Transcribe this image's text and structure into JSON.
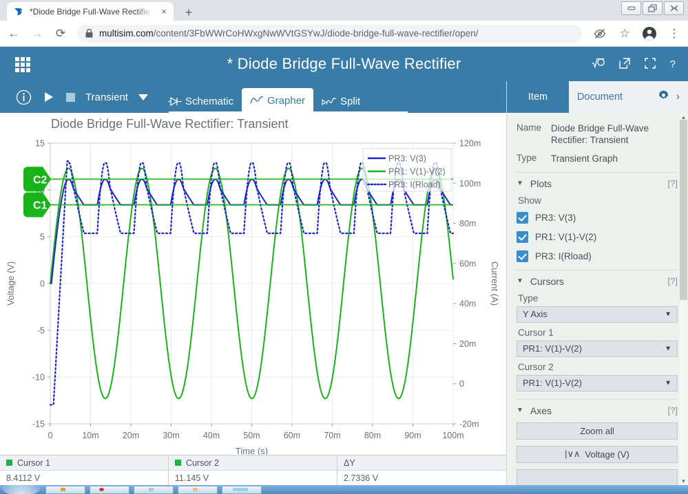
{
  "browser": {
    "tab": {
      "title": "*Diode Bridge Full-Wave Rectifie",
      "favicon": "multisim-bird-icon",
      "close": "×"
    },
    "newtab_label": "+",
    "window_controls": {
      "minimize": "–",
      "restore": "❐",
      "close": "✕"
    },
    "nav": {
      "back": "←",
      "forward": "→",
      "reload": "⟳"
    },
    "omnibox": {
      "lock": "lock-icon",
      "url_domain": "multisim.com",
      "url_path": "/content/3FbWWrCoHWxgNwWVtGSYwJ/diode-bridge-full-wave-rectifier/open/"
    },
    "right_icons": {
      "hidden": "eye-slash-icon",
      "bookmark": "☆",
      "profile": "profile-avatar-icon",
      "menu": "⋮"
    }
  },
  "app": {
    "grid_icon": "app-grid-icon",
    "title": "* Diode Bridge Full-Wave Rectifier",
    "header_icons": {
      "simulate": "√Ⓢ",
      "share": "↗",
      "fullscreen": "⛶",
      "help": "?"
    }
  },
  "toolbar": {
    "info": "ⓘ",
    "run": "▶",
    "stop": "■",
    "analysis": "Transient",
    "dropdown": "▼",
    "tabs": [
      {
        "label": "Schematic",
        "icon": "diode-icon",
        "active": false
      },
      {
        "label": "Grapher",
        "icon": "waveform-icon",
        "active": true
      },
      {
        "label": "Split",
        "icon": "split-view-icon",
        "active": false
      }
    ]
  },
  "chart_data": {
    "type": "line",
    "title": "Diode Bridge Full-Wave Rectifier: Transient",
    "xlabel": "Time (s)",
    "ylabel": "Voltage (V)",
    "y2label": "Current (A)",
    "xlim": [
      0,
      0.1
    ],
    "ylim": [
      -15,
      15
    ],
    "y2lim": [
      -0.02,
      0.12
    ],
    "xticks": [
      "0",
      "10m",
      "20m",
      "30m",
      "40m",
      "50m",
      "60m",
      "70m",
      "80m",
      "90m",
      "100m"
    ],
    "xtick_values": [
      0,
      0.01,
      0.02,
      0.03,
      0.04,
      0.05,
      0.06,
      0.07,
      0.08,
      0.09,
      0.1
    ],
    "yticks": [
      "15",
      "10",
      "5",
      "0",
      "-5",
      "-10",
      "-15"
    ],
    "ytick_values": [
      15,
      10,
      5,
      0,
      -5,
      -10,
      -15
    ],
    "y2ticks": [
      "120m",
      "100m",
      "80m",
      "60m",
      "40m",
      "20m",
      "0",
      "-20m"
    ],
    "y2tick_values": [
      0.12,
      0.1,
      0.08,
      0.06,
      0.04,
      0.02,
      0,
      -0.02
    ],
    "grid": true,
    "legend_position": "top-right",
    "series": [
      {
        "name": "PR3: V(3)",
        "color": "#1d25d0",
        "style": "solid",
        "axis": "left",
        "description": "Rectified DC output with ripple, peaks ~11.1 V, troughs ~8.4 V, ripple period ~9.1 ms",
        "peak": 11.1,
        "trough": 8.4,
        "ripple_period_s": 0.0091
      },
      {
        "name": "PR1: V(1)-V(2)",
        "color": "#18b318",
        "style": "solid",
        "axis": "left",
        "description": "AC input sine wave, amplitude 12.3 V, period ~18.2 ms (55 Hz)",
        "amplitude": 12.3,
        "period_s": 0.0182
      },
      {
        "name": "PR3: I(Rload)",
        "color": "#1d25d0",
        "style": "dotted",
        "axis": "right",
        "description": "Load current ripple, peaks ~111 mA, troughs ~84 mA",
        "peak": 0.111,
        "trough": 0.084
      }
    ],
    "cursors": [
      {
        "label": "C2",
        "axis": "left",
        "value": 11.145,
        "color": "#18b318"
      },
      {
        "label": "C1",
        "axis": "left",
        "value": 8.4112,
        "color": "#18b318"
      }
    ]
  },
  "status": {
    "columns": [
      {
        "marker": true,
        "header": "Cursor 1",
        "value": "8.4112 V"
      },
      {
        "marker": true,
        "header": "Cursor 2",
        "value": "11.145 V"
      },
      {
        "marker": false,
        "header": "ΔY",
        "value": "2.7336 V"
      }
    ]
  },
  "panel": {
    "tabs": [
      {
        "label": "Item",
        "active": true
      },
      {
        "label": "Document",
        "active": false
      }
    ],
    "gear": "gear-icon",
    "expand": "›",
    "name_label": "Name",
    "name_value": "Diode Bridge Full-Wave Rectifier: Transient",
    "type_label": "Type",
    "type_value": "Transient Graph",
    "plots": {
      "title": "Plots",
      "help": "[?]",
      "caret": "▼",
      "show_label": "Show",
      "items": [
        {
          "label": "PR3: V(3)",
          "checked": true
        },
        {
          "label": "PR1: V(1)-V(2)",
          "checked": true
        },
        {
          "label": "PR3: I(Rload)",
          "checked": true
        }
      ]
    },
    "cursors": {
      "title": "Cursors",
      "help": "[?]",
      "caret": "▼",
      "type_label": "Type",
      "type_value": "Y Axis",
      "cursor1_label": "Cursor 1",
      "cursor1_value": "PR1: V(1)-V(2)",
      "cursor2_label": "Cursor 2",
      "cursor2_value": "PR1: V(1)-V(2)"
    },
    "axes": {
      "title": "Axes",
      "help": "[?]",
      "caret": "▼",
      "zoom_all": "Zoom all",
      "voltage_button": "Voltage (V)",
      "voltage_icon": "|∨∧"
    },
    "scroll_up": "▲",
    "scroll_down": "▼"
  }
}
